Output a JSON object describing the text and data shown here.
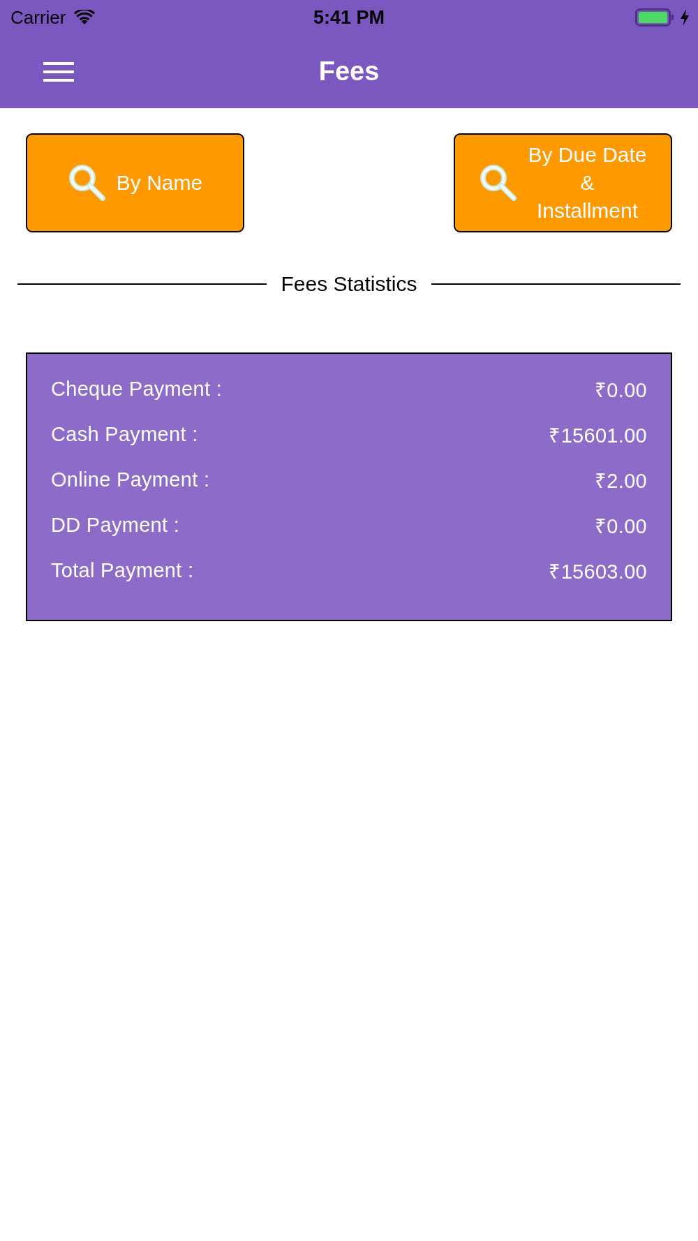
{
  "status_bar": {
    "carrier": "Carrier",
    "time": "5:41 PM"
  },
  "nav_bar": {
    "title": "Fees"
  },
  "search_buttons": [
    {
      "label": "By Name"
    },
    {
      "label": "By Due Date\n&\nInstallment"
    }
  ],
  "section_title": "Fees Statistics",
  "stats": [
    {
      "label": "Cheque Payment :",
      "value": "₹0.00"
    },
    {
      "label": "Cash Payment :",
      "value": "₹15601.00"
    },
    {
      "label": "Online Payment :",
      "value": "₹2.00"
    },
    {
      "label": "DD Payment :",
      "value": "₹0.00"
    },
    {
      "label": "Total Payment :",
      "value": "₹15603.00"
    }
  ]
}
